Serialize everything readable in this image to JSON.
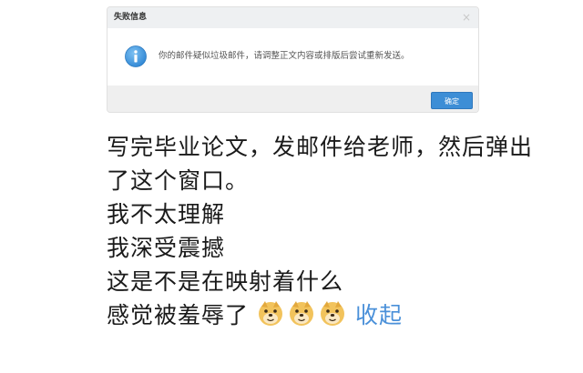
{
  "dialog": {
    "title": "失败信息",
    "close_glyph": "×",
    "icon": "info-icon",
    "message": "你的邮件疑似垃圾邮件，请调整正文内容或排版后尝试重新发送。",
    "ok_label": "确定",
    "accent_color": "#3d8ed6"
  },
  "post": {
    "lines": [
      "写完毕业论文，发邮件给老师，然后弹出",
      "了这个窗口。",
      "我不太理解",
      "我深受震撼",
      "这是不是在映射着什么",
      "感觉被羞辱了"
    ],
    "emojis": [
      "doge-emoji",
      "doge-emoji",
      "doge-emoji"
    ],
    "collapse_label": "收起",
    "link_color": "#4a90d9"
  }
}
